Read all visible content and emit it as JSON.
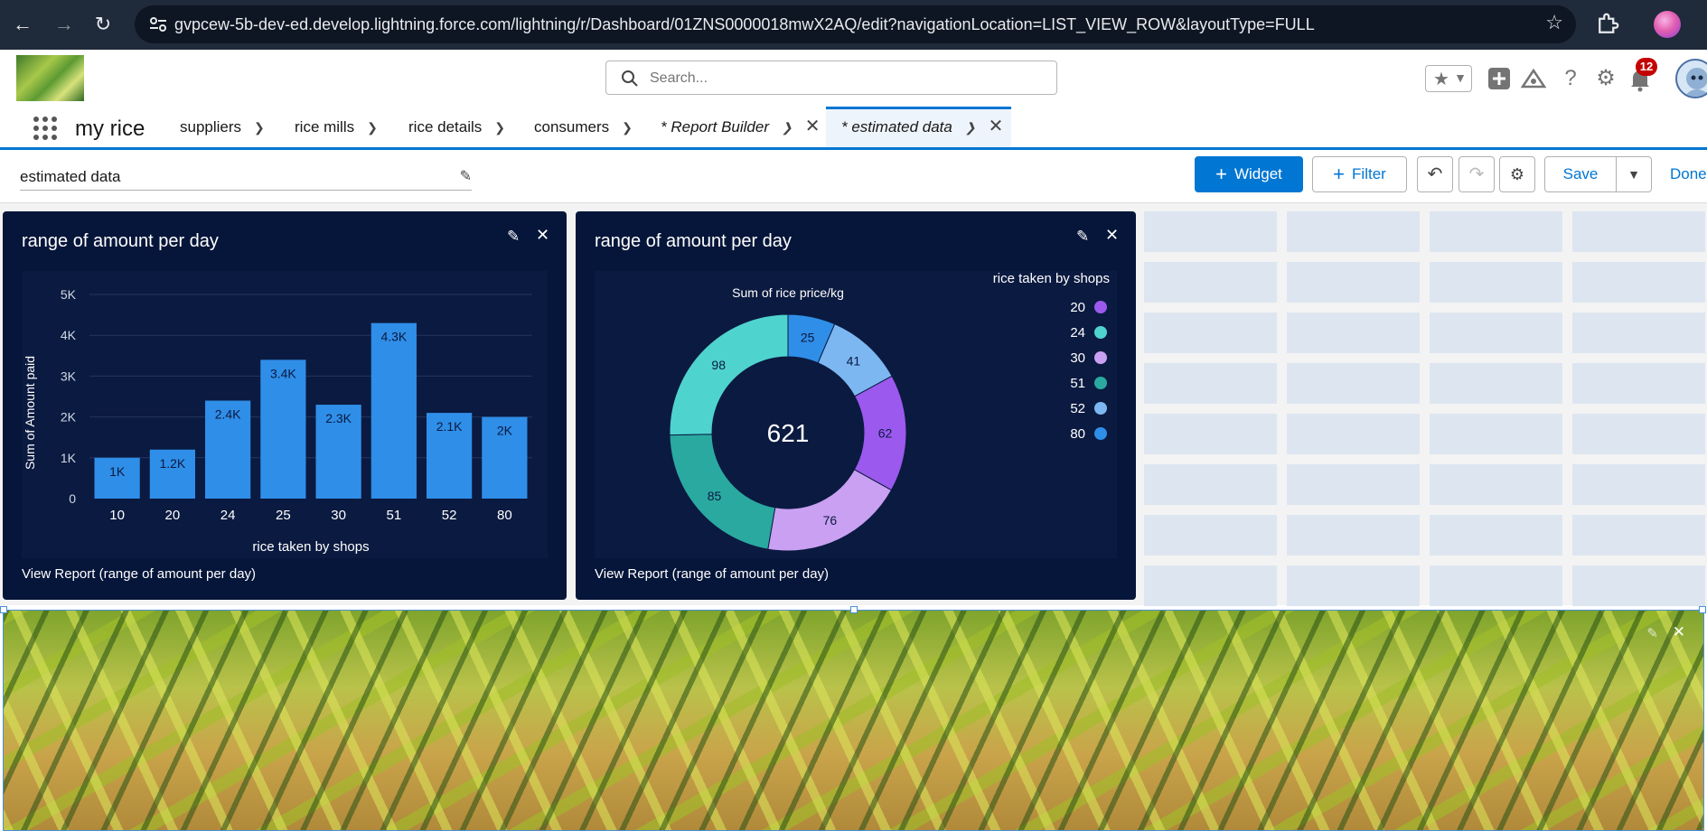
{
  "browser": {
    "url": "gvpcew-5b-dev-ed.develop.lightning.force.com/lightning/r/Dashboard/01ZNS0000018mwX2AQ/edit?navigationLocation=LIST_VIEW_ROW&layoutType=FULL"
  },
  "header": {
    "search_placeholder": "Search...",
    "notification_count": "12"
  },
  "nav": {
    "app_name": "my rice",
    "tabs": [
      {
        "label": "suppliers"
      },
      {
        "label": "rice mills"
      },
      {
        "label": "rice details"
      },
      {
        "label": "consumers"
      },
      {
        "label": "* Report Builder"
      },
      {
        "label": "* estimated data"
      }
    ]
  },
  "toolbar": {
    "dashboard_name": "estimated data",
    "widget_label": "Widget",
    "filter_label": "Filter",
    "save_label": "Save",
    "done_label": "Done"
  },
  "widgets": [
    {
      "title": "range of amount per day",
      "view_report": "View Report (range of amount per day)"
    },
    {
      "title": "range of amount per day",
      "view_report": "View Report (range of amount per day)"
    }
  ],
  "colors": {
    "brand": "#0176d3",
    "widget_bg": "#06163a",
    "bar": "#2f8ee8",
    "donut": [
      "#2f8ee8",
      "#7cb7f2",
      "#9b59ee",
      "#c9a0f2",
      "#2aa9a1",
      "#4fd3cf"
    ]
  },
  "chart_data": [
    {
      "type": "bar",
      "categories": [
        "10",
        "20",
        "24",
        "25",
        "30",
        "51",
        "52",
        "80"
      ],
      "values": [
        1000,
        1200,
        2400,
        3400,
        2300,
        4300,
        2100,
        2000
      ],
      "data_labels": [
        "1K",
        "1.2K",
        "2.4K",
        "3.4K",
        "2.3K",
        "4.3K",
        "2.1K",
        "2K"
      ],
      "yticks": [
        "0",
        "1K",
        "2K",
        "3K",
        "4K",
        "5K"
      ],
      "ylim": [
        0,
        5000
      ],
      "xlabel": "rice taken by shops",
      "ylabel": "Sum of Amount paid",
      "grid": true
    },
    {
      "type": "pie",
      "variant": "donut",
      "title": "Sum of rice price/kg",
      "legend_title": "rice taken by shops",
      "legend_position": "top-right",
      "total": "621",
      "slices": [
        {
          "label": "80",
          "value": 25
        },
        {
          "label": "52",
          "value": 41
        },
        {
          "label": "20",
          "value": 62
        },
        {
          "label": "30",
          "value": 76
        },
        {
          "label": "51",
          "value": 85
        },
        {
          "label": "24",
          "value": 98
        }
      ],
      "legend": [
        "20",
        "24",
        "30",
        "51",
        "52",
        "80"
      ]
    }
  ]
}
